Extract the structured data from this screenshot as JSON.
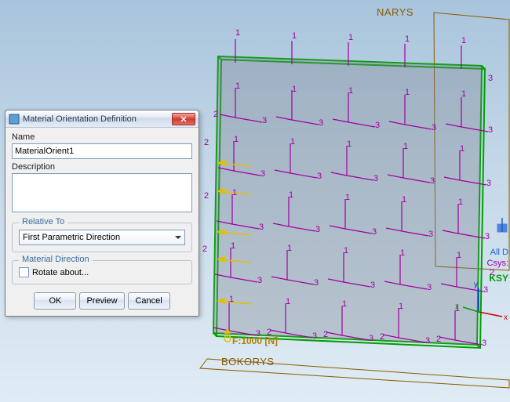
{
  "viewport": {
    "labels": {
      "top": "NARYS",
      "bottom": "BOKORYS",
      "right_green": "KSY",
      "right_blue": "All D",
      "csys": "Csys:",
      "axes": {
        "x": "x",
        "y": "y",
        "z": "z"
      }
    },
    "force_label": "F:1000 [N]",
    "coord_labels": [
      "1",
      "2",
      "3"
    ]
  },
  "dialog": {
    "title": "Material Orientation Definition",
    "name_label": "Name",
    "name_value": "MaterialOrient1",
    "description_label": "Description",
    "description_value": "",
    "relative_to_legend": "Relative To",
    "relative_to_value": "First Parametric Direction",
    "material_direction_legend": "Material Direction",
    "rotate_about_label": "Rotate about...",
    "buttons": {
      "ok": "OK",
      "preview": "Preview",
      "cancel": "Cancel"
    }
  }
}
